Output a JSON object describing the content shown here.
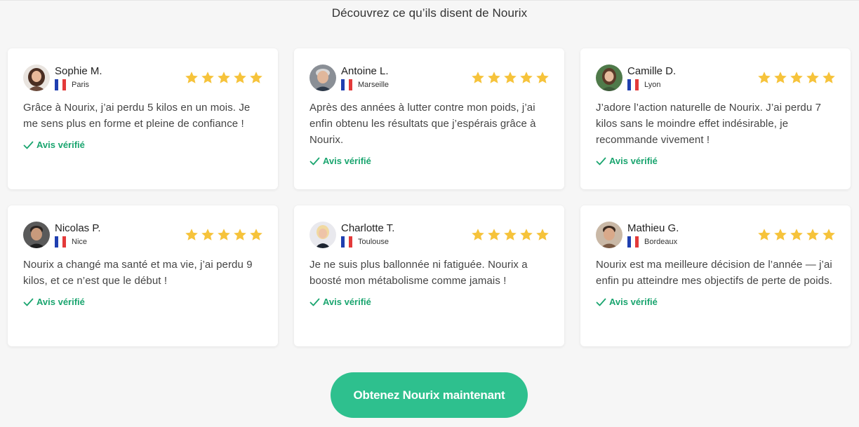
{
  "section": {
    "headline": "Découvrez ce qu’ils disent de Nourix"
  },
  "colors": {
    "background": "#f6f6f6",
    "star": "#f6c33b",
    "verified_green": "#1aa56f",
    "cta_green": "#2ec08e",
    "flag_blue": "#1f3fb0",
    "flag_red": "#e33a3a"
  },
  "rating_max": 5,
  "reviews": [
    {
      "name": "Sophie M.",
      "city": "Paris",
      "flag_icon": "france-flag-icon",
      "rating": 5,
      "text": "Grâce à Nourix, j’ai perdu 5 kilos en un mois. Je me sens plus en forme et pleine de confiance !",
      "verified_label": "Avis vérifié"
    },
    {
      "name": "Antoine L.",
      "city": "Marseille",
      "flag_icon": "france-flag-icon",
      "rating": 5,
      "text": "Après des années à lutter contre mon poids, j’ai enfin obtenu les résultats que j’espérais grâce à Nourix.",
      "verified_label": "Avis vérifié"
    },
    {
      "name": "Camille D.",
      "city": "Lyon",
      "flag_icon": "france-flag-icon",
      "rating": 5,
      "text": "J’adore l’action naturelle de Nourix. J’ai perdu 7 kilos sans le moindre effet indésirable, je recommande vivement !",
      "verified_label": "Avis vérifié"
    },
    {
      "name": "Nicolas P.",
      "city": "Nice",
      "flag_icon": "france-flag-icon",
      "rating": 5,
      "text": "Nourix a changé ma santé et ma vie, j’ai perdu 9 kilos, et ce n’est que le début !",
      "verified_label": "Avis vérifié"
    },
    {
      "name": "Charlotte T.",
      "city": "Toulouse",
      "flag_icon": "france-flag-icon",
      "rating": 5,
      "text": "Je ne suis plus ballonnée ni fatiguée. Nourix a boosté mon métabolisme comme jamais !",
      "verified_label": "Avis vérifié"
    },
    {
      "name": "Mathieu G.",
      "city": "Bordeaux",
      "flag_icon": "france-flag-icon",
      "rating": 5,
      "text": "Nourix est ma meilleure décision de l’année — j’ai enfin pu atteindre mes objectifs de perte de poids.",
      "verified_label": "Avis vérifié"
    }
  ],
  "cta": {
    "label": "Obtenez Nourix maintenant"
  }
}
